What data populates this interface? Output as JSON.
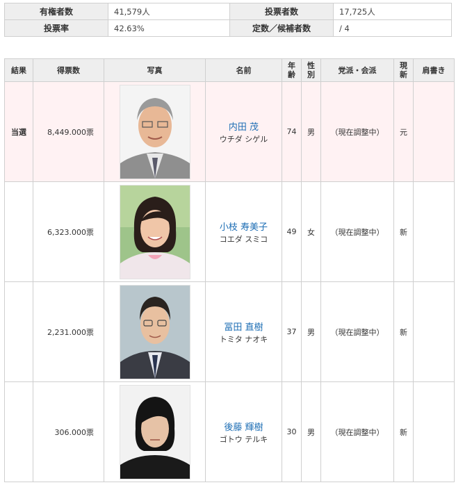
{
  "summary": {
    "eligible_label": "有権者数",
    "eligible_value": "41,579人",
    "voters_label": "投票者数",
    "voters_value": "17,725人",
    "turnout_label": "投票率",
    "turnout_value": "42.63%",
    "seats_label": "定数／候補者数",
    "seats_value": "/ 4"
  },
  "headers": {
    "result": "結果",
    "votes": "得票数",
    "photo": "写真",
    "name": "名前",
    "age_line1": "年",
    "age_line2": "齢",
    "sex_line1": "性",
    "sex_line2": "別",
    "party": "党派・会派",
    "status_line1": "現",
    "status_line2": "新",
    "title": "肩書き"
  },
  "candidates": [
    {
      "result": "当選",
      "votes": "8,449.000票",
      "name": "内田 茂",
      "kana": "ウチダ シゲル",
      "age": "74",
      "sex": "男",
      "party": "（現在調整中）",
      "status": "元",
      "title": ""
    },
    {
      "result": "",
      "votes": "6,323.000票",
      "name": "小枝 寿美子",
      "kana": "コエダ スミコ",
      "age": "49",
      "sex": "女",
      "party": "（現在調整中）",
      "status": "新",
      "title": ""
    },
    {
      "result": "",
      "votes": "2,231.000票",
      "name": "冨田 直樹",
      "kana": "トミタ ナオキ",
      "age": "37",
      "sex": "男",
      "party": "（現在調整中）",
      "status": "新",
      "title": ""
    },
    {
      "result": "",
      "votes": "306.000票",
      "name": "後藤 輝樹",
      "kana": "ゴトウ テルキ",
      "age": "30",
      "sex": "男",
      "party": "（現在調整中）",
      "status": "新",
      "title": ""
    }
  ],
  "colors": {
    "winner_row_bg": "#fff2f3",
    "winner_text": "#d00000",
    "name_link": "#1f6fb5",
    "header_bg": "#eeeeee"
  }
}
